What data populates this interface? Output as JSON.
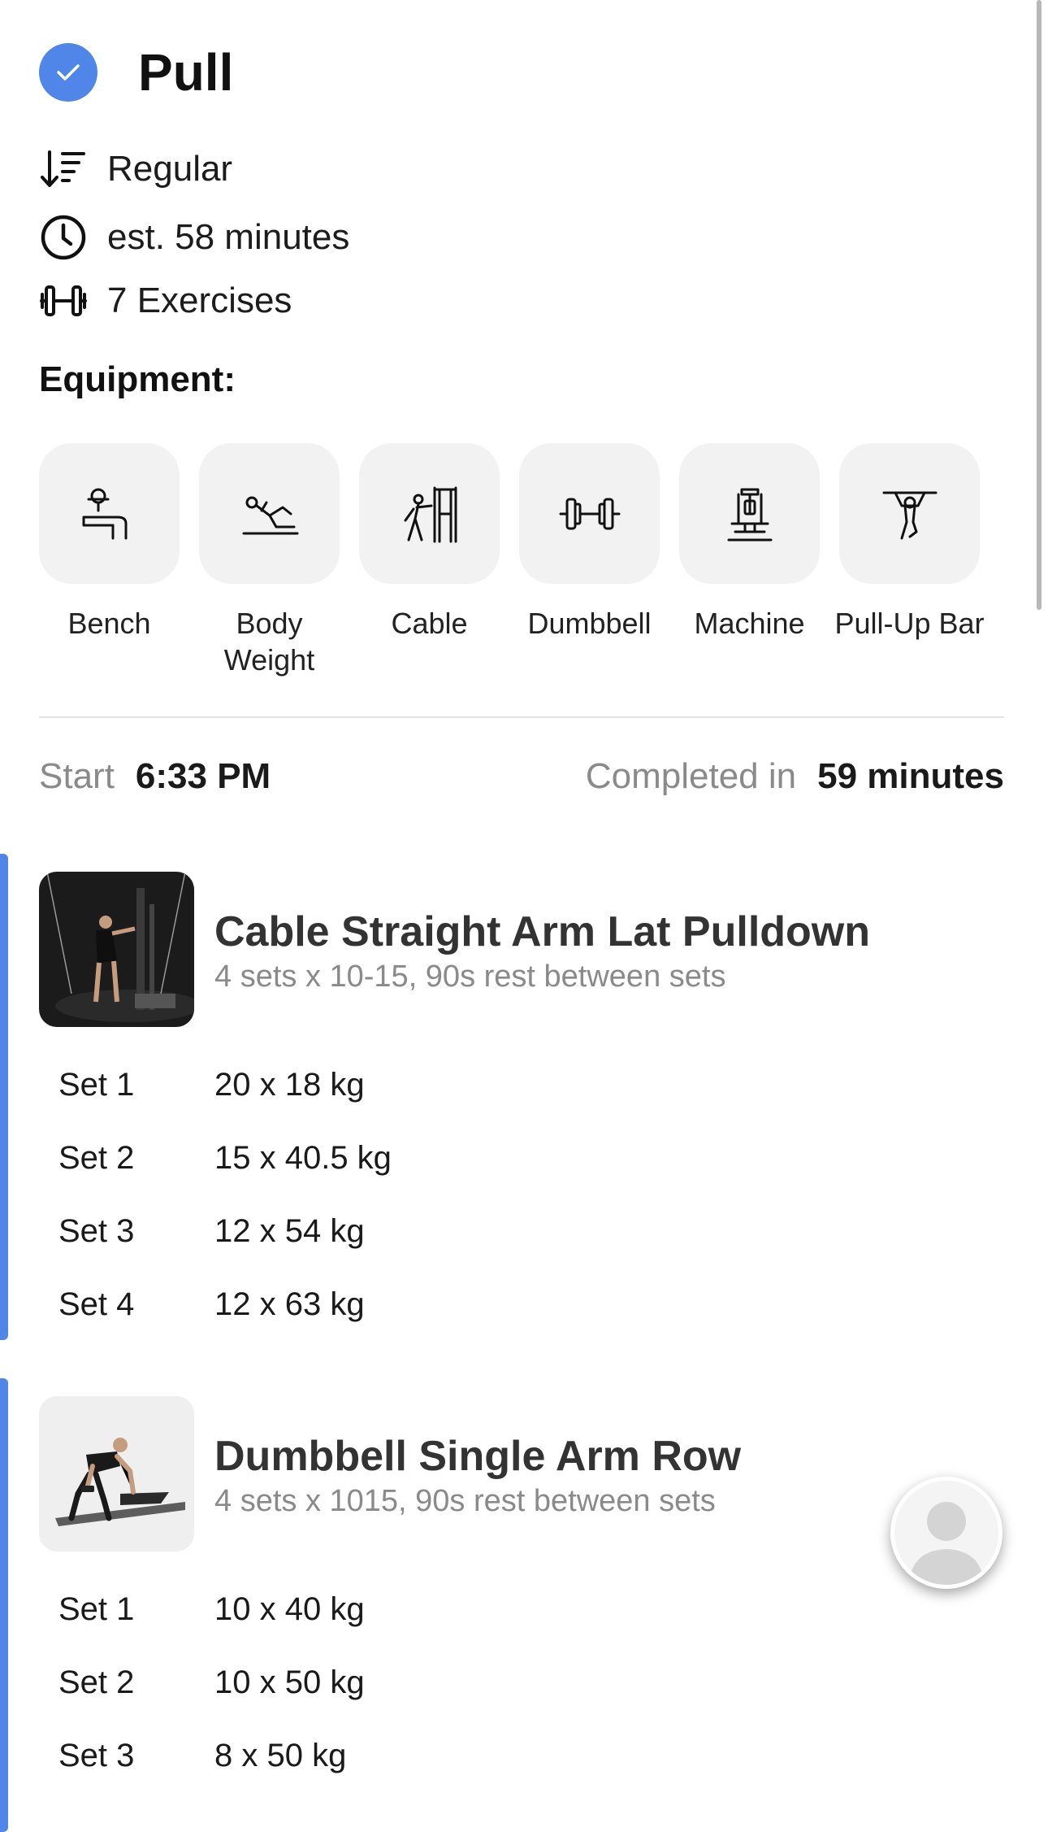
{
  "workout": {
    "title": "Pull",
    "type": "Regular",
    "duration": "est. 58 minutes",
    "exercise_count": "7 Exercises"
  },
  "equipment": {
    "heading": "Equipment:",
    "items": [
      {
        "label": "Bench",
        "icon": "bench-icon"
      },
      {
        "label": "Body Weight",
        "icon": "body-weight-icon"
      },
      {
        "label": "Cable",
        "icon": "cable-icon"
      },
      {
        "label": "Dumbbell",
        "icon": "dumbbell-icon"
      },
      {
        "label": "Machine",
        "icon": "machine-icon"
      },
      {
        "label": "Pull-Up Bar",
        "icon": "pull-up-bar-icon"
      }
    ]
  },
  "session": {
    "start_label": "Start",
    "start_value": "6:33 PM",
    "completed_label": "Completed in",
    "completed_value": "59 minutes"
  },
  "exercises": [
    {
      "name": "Cable Straight Arm Lat Pulldown",
      "detail": "4 sets x 10-15, 90s rest between sets",
      "sets": [
        {
          "label": "Set 1",
          "value": "20 x 18 kg"
        },
        {
          "label": "Set 2",
          "value": "15 x 40.5 kg"
        },
        {
          "label": "Set 3",
          "value": "12 x 54 kg"
        },
        {
          "label": "Set 4",
          "value": "12 x 63 kg"
        }
      ]
    },
    {
      "name": "Dumbbell Single Arm Row",
      "detail": "4 sets x 1015, 90s rest between sets",
      "sets": [
        {
          "label": "Set 1",
          "value": "10 x 40 kg"
        },
        {
          "label": "Set 2",
          "value": "10 x 50 kg"
        },
        {
          "label": "Set 3",
          "value": "8 x 50 kg"
        }
      ]
    }
  ],
  "colors": {
    "accent": "#4f86e8",
    "tile": "#f2f2f2",
    "muted": "#8a8a8a"
  }
}
